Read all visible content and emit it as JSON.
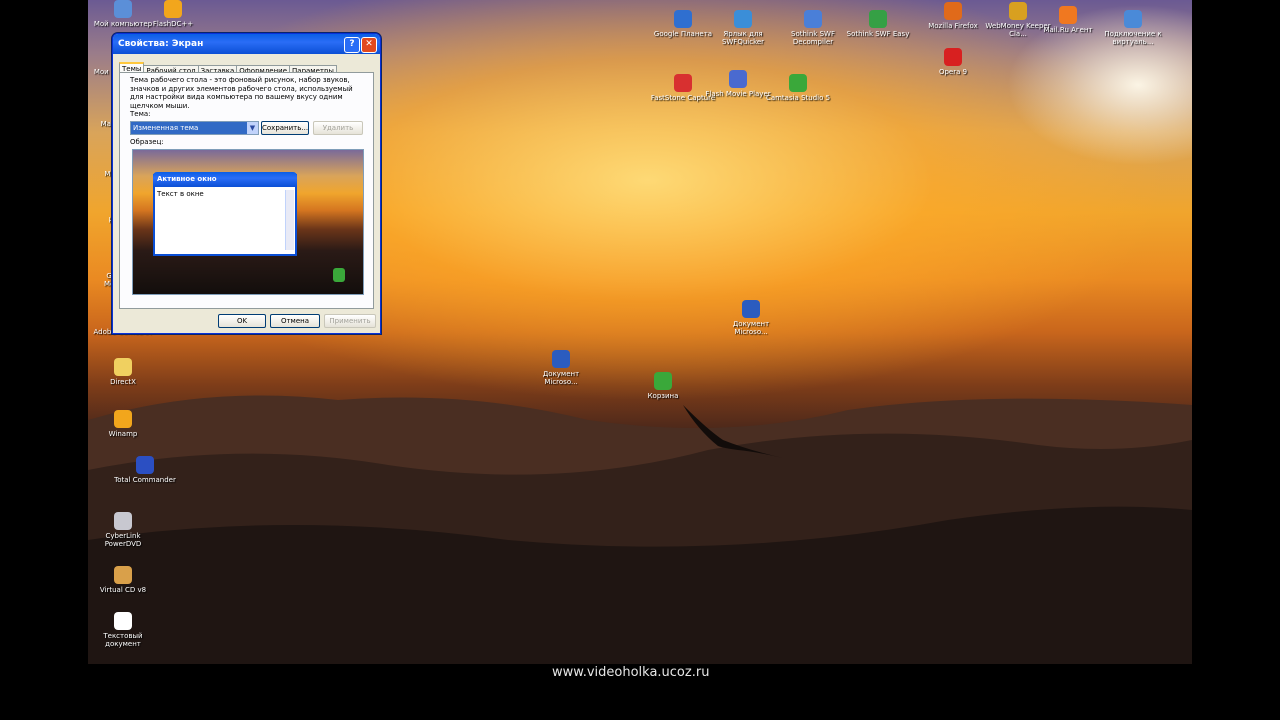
{
  "desktop": {
    "left_icons": [
      {
        "label": "Мой компьютер",
        "icon": "my-computer-icon",
        "color": "#5b8fd8"
      },
      {
        "label": "FlashDC++",
        "icon": "flashdc-icon",
        "color": "#f2a61c"
      },
      {
        "label": "Мои документы",
        "icon": "my-documents-icon",
        "color": "#e8c45a"
      },
      {
        "label": "Mail Updater",
        "icon": "mail-updater-icon",
        "color": "#2c9f2c"
      },
      {
        "label": "Mail Agent",
        "icon": "mail-agent-icon",
        "color": "#2c9f2c"
      },
      {
        "label": "µTorrent",
        "icon": "utorrent-icon",
        "color": "#3aa83a"
      },
      {
        "label": "GameNet Messenger",
        "icon": "gamenet-icon",
        "color": "#9a9a9a"
      },
      {
        "label": "Adobe GameDev",
        "icon": "adobe-icon",
        "color": "#e2641e"
      },
      {
        "label": "DirectX",
        "icon": "folder-icon",
        "color": "#f0d060"
      },
      {
        "label": "Winamp",
        "icon": "winamp-icon",
        "color": "#f2a61c"
      },
      {
        "label": "Total Commander",
        "icon": "total-commander-icon",
        "color": "#2b4fc2"
      },
      {
        "label": "CyberLink PowerDVD",
        "icon": "powerdvd-icon",
        "color": "#c8c8d0"
      },
      {
        "label": "Virtual CD v8",
        "icon": "virtual-cd-icon",
        "color": "#d9a04a"
      },
      {
        "label": "Текстовый документ",
        "icon": "text-document-icon",
        "color": "#ffffff"
      }
    ],
    "top_icons": [
      {
        "label": "Google Планета",
        "icon": "google-earth-icon",
        "color": "#2f6fd0"
      },
      {
        "label": "Ярлык для SWFQuicker",
        "icon": "swfquicker-icon",
        "color": "#3b8ed8"
      },
      {
        "label": "Sothink SWF Decompiler",
        "icon": "sothink-decompiler-icon",
        "color": "#4a7fd8"
      },
      {
        "label": "Sothink SWF Easy",
        "icon": "sothink-easy-icon",
        "color": "#35a045"
      },
      {
        "label": "Mozilla Firefox",
        "icon": "firefox-icon",
        "color": "#e06a1a"
      },
      {
        "label": "WebMoney Keeper Cla...",
        "icon": "webmoney-icon",
        "color": "#d8a020"
      },
      {
        "label": "Mail.Ru Агент",
        "icon": "mailru-agent-icon",
        "color": "#f07820"
      },
      {
        "label": "Подключение к виртуаль...",
        "icon": "network-connection-icon",
        "color": "#4a8ad8"
      },
      {
        "label": "FastStone Capture",
        "icon": "faststone-icon",
        "color": "#d83030"
      },
      {
        "label": "Flash Movie Player",
        "icon": "flash-player-icon",
        "color": "#4a6ad0"
      },
      {
        "label": "Camtasia Studio 5",
        "icon": "camtasia-icon",
        "color": "#3aa83a"
      },
      {
        "label": "Opera 9",
        "icon": "opera-icon",
        "color": "#d82020"
      }
    ],
    "center_icons": [
      {
        "label": "Документ Microso...",
        "icon": "word-document-icon",
        "color": "#2b5cbf"
      },
      {
        "label": "Документ Microso...",
        "icon": "word-document-icon",
        "color": "#2b5cbf"
      },
      {
        "label": "Корзина",
        "icon": "recycle-bin-icon",
        "color": "#3aa83a"
      }
    ]
  },
  "dialog": {
    "title": "Свойства: Экран",
    "help": "?",
    "close": "✕",
    "tabs": [
      "Темы",
      "Рабочий стол",
      "Заставка",
      "Оформление",
      "Параметры"
    ],
    "description": "Тема рабочего стола - это фоновый рисунок, набор звуков, значков и других элементов рабочего стола, используемый для настройки вида компьютера по вашему вкусу одним щелчком мыши.",
    "theme_label": "Тема:",
    "theme_value": "Измененная тема",
    "save_button": "Сохранить...",
    "delete_button": "Удалить",
    "sample_label": "Образец:",
    "preview_window_title": "Активное окно",
    "preview_window_text": "Текст в окне",
    "ok_button": "OK",
    "cancel_button": "Отмена",
    "apply_button": "Применить"
  },
  "watermark": "www.videoholka.ucoz.ru"
}
